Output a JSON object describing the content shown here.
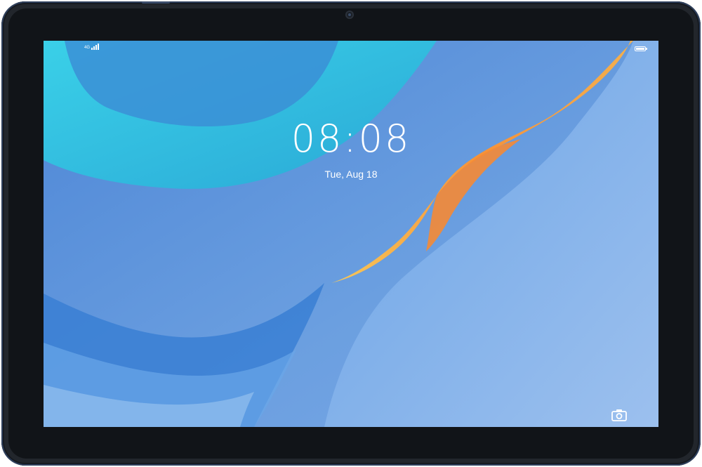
{
  "device": {
    "frame_color": "#22262c",
    "accent_color": "#2e3f5c"
  },
  "status_bar": {
    "network_label": "4G",
    "signal_icon": "signal-bars-icon",
    "battery_icon": "battery-icon",
    "battery_level": 0.9
  },
  "lock_screen": {
    "time": "08:08",
    "date": "Tue, Aug 18",
    "camera_shortcut_icon": "camera-icon"
  },
  "wallpaper": {
    "colors": {
      "base": "#5f95dc",
      "teal": "#3ec3df",
      "deep_blue": "#2f6fc6",
      "orange": "#f59a3b",
      "light_blue": "#8fb8ec"
    }
  }
}
